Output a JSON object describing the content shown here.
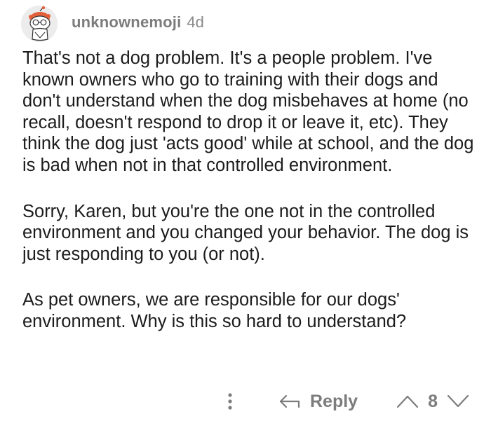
{
  "comment": {
    "username": "unknownemoji",
    "age": "4d",
    "paragraphs": [
      "That's not a dog problem. It's a people problem. I've known owners who go to training with their dogs and don't understand when the dog misbehaves at home (no recall, doesn't respond to drop it or leave it, etc). They think the dog just 'acts good' while at school, and the dog is bad when not in that controlled environment.",
      "Sorry, Karen, but you're the one not in the controlled environment and you changed your behavior. The dog is just responding to you (or not).",
      "As pet owners, we are responsible for our dogs' environment. Why is this so hard to understand?"
    ],
    "actions": {
      "reply_label": "Reply",
      "score": "8"
    }
  },
  "colors": {
    "avatar_accent": "#e2613a",
    "muted_text": "#7c7c7c"
  },
  "icons": {
    "more": "vertical-dots-icon",
    "reply": "reply-arrow-icon",
    "upvote": "upvote-icon",
    "downvote": "downvote-icon"
  }
}
